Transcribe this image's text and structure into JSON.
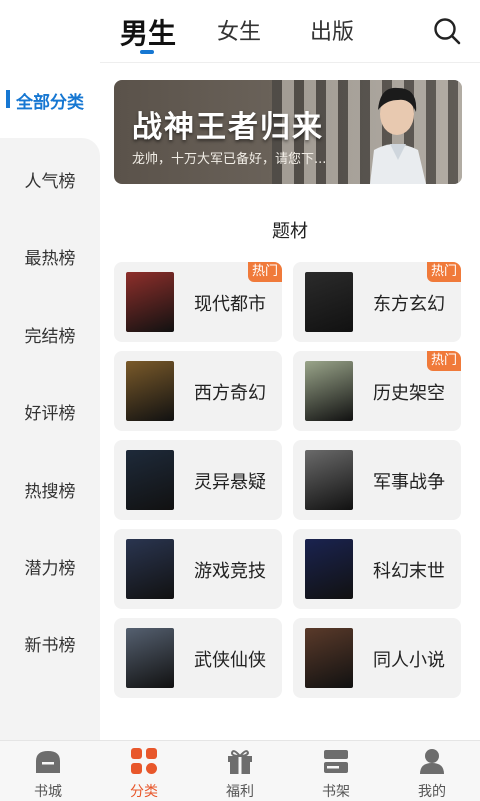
{
  "top_tabs": [
    {
      "label": "男生",
      "active": true
    },
    {
      "label": "女生",
      "active": false
    },
    {
      "label": "出版",
      "active": false
    }
  ],
  "sidebar": [
    {
      "label": "全部分类",
      "active": true
    },
    {
      "label": "人气榜"
    },
    {
      "label": "最热榜"
    },
    {
      "label": "完结榜"
    },
    {
      "label": "好评榜"
    },
    {
      "label": "热搜榜"
    },
    {
      "label": "潜力榜"
    },
    {
      "label": "新书榜"
    }
  ],
  "banner": {
    "title": "战神王者归来",
    "subtitle": "龙帅，十万大军已备好，请您下..."
  },
  "section_title": "题材",
  "hot_label": "热门",
  "categories": [
    {
      "label": "现代都市",
      "hot": true,
      "cover_color": "#8e2f2b"
    },
    {
      "label": "东方玄幻",
      "hot": true,
      "cover_color": "#2b2b2b"
    },
    {
      "label": "西方奇幻",
      "hot": false,
      "cover_color": "#7a5a2a"
    },
    {
      "label": "历史架空",
      "hot": true,
      "cover_color": "#9aa58a"
    },
    {
      "label": "灵异悬疑",
      "hot": false,
      "cover_color": "#1e2a3a"
    },
    {
      "label": "军事战争",
      "hot": false,
      "cover_color": "#6a6a6a"
    },
    {
      "label": "游戏竞技",
      "hot": false,
      "cover_color": "#2a3550"
    },
    {
      "label": "科幻末世",
      "hot": false,
      "cover_color": "#1a2350"
    },
    {
      "label": "武侠仙侠",
      "hot": false,
      "cover_color": "#556070"
    },
    {
      "label": "同人小说",
      "hot": false,
      "cover_color": "#5a3a2a"
    }
  ],
  "bottom_nav": [
    {
      "label": "书城",
      "icon": "bookstore-icon"
    },
    {
      "label": "分类",
      "icon": "category-icon",
      "active": true
    },
    {
      "label": "福利",
      "icon": "gift-icon"
    },
    {
      "label": "书架",
      "icon": "bookshelf-icon"
    },
    {
      "label": "我的",
      "icon": "profile-icon"
    }
  ],
  "colors": {
    "accent": "#1677d2",
    "hot": "#f07a3a",
    "nav_active": "#e8572b"
  }
}
